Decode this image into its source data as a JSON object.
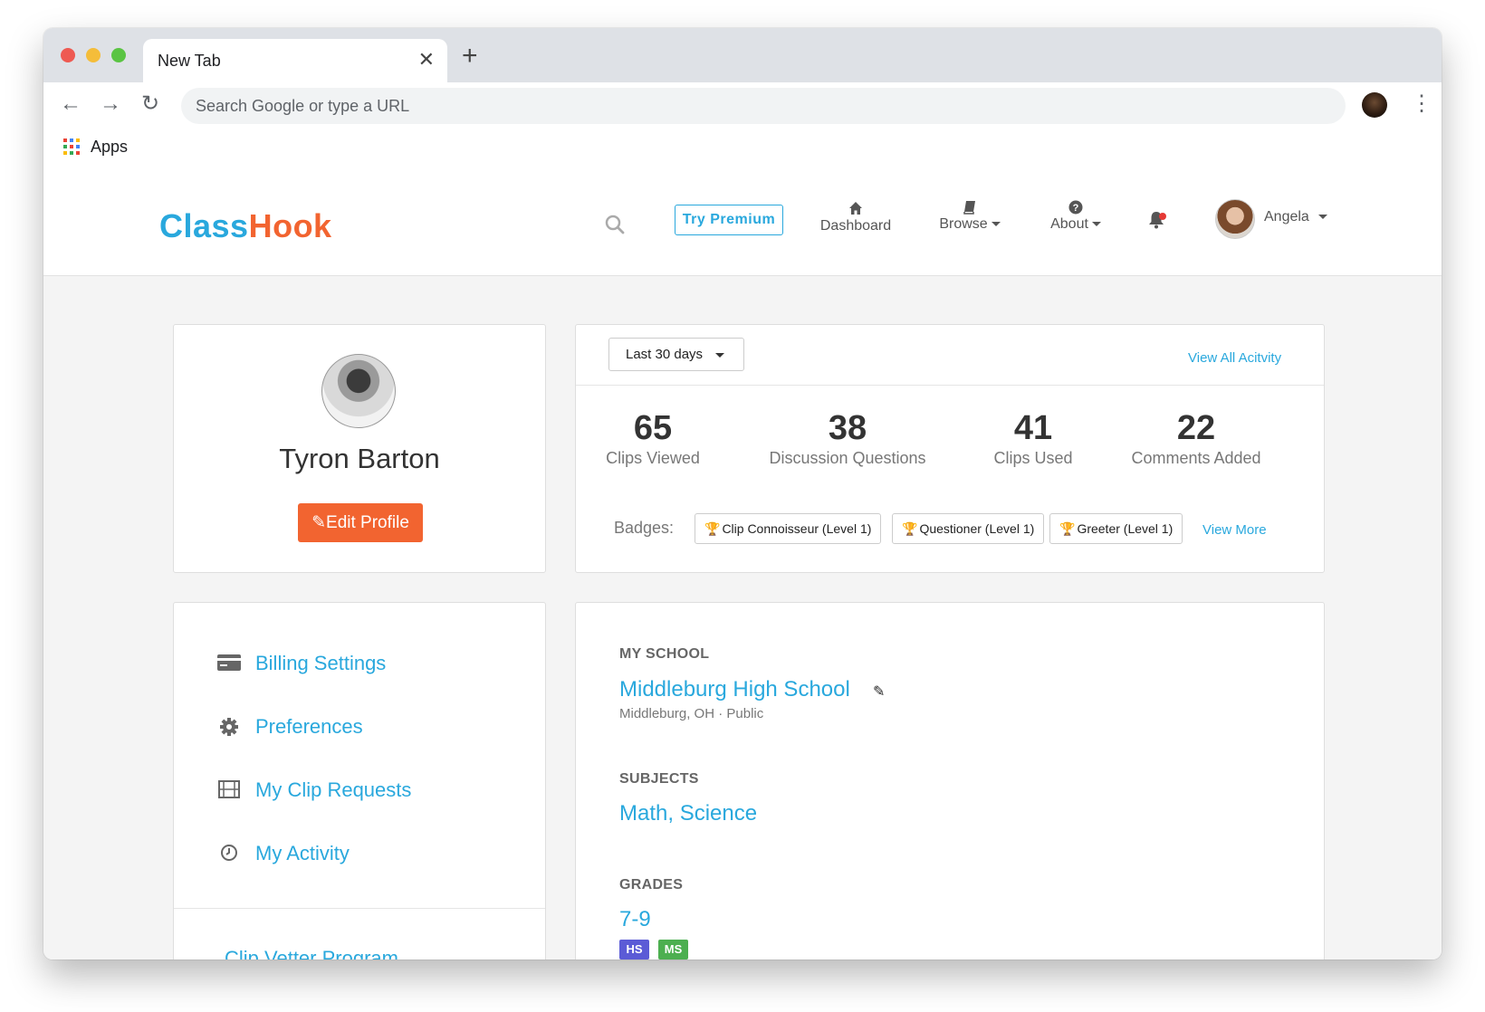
{
  "browser": {
    "tab_title": "New Tab",
    "tab_close": "✕",
    "new_tab": "+",
    "back": "←",
    "forward": "→",
    "reload": "↻",
    "omnibox_placeholder": "Search Google or type a URL",
    "menu": "⋮",
    "bookmarks": {
      "apps_label": "Apps"
    }
  },
  "site": {
    "logo_part1": "Class",
    "logo_part2": "Hook",
    "try_premium": "Try Premium",
    "nav": {
      "dashboard": {
        "label": "Dashboard",
        "icon": "home-icon"
      },
      "browse": {
        "label": "Browse",
        "icon": "book-icon"
      },
      "about": {
        "label": "About",
        "icon": "question-circle-icon"
      }
    },
    "user_name": "Angela"
  },
  "profile": {
    "name": "Tyron Barton",
    "edit_label": "Edit Profile"
  },
  "activity": {
    "range": "Last 30 days",
    "view_all": "View All Acitvity",
    "stats": [
      {
        "value": "65",
        "label": "Clips Viewed"
      },
      {
        "value": "38",
        "label": "Discussion Questions"
      },
      {
        "value": "41",
        "label": "Clips Used"
      },
      {
        "value": "22",
        "label": "Comments Added"
      }
    ],
    "badges_label": "Badges:",
    "badges": [
      "Clip Connoisseur (Level 1)",
      "Questioner (Level 1)",
      "Greeter (Level 1)"
    ],
    "view_more": "View More"
  },
  "menu": {
    "items": [
      {
        "label": "Billing Settings",
        "icon": "credit-card-icon"
      },
      {
        "label": "Preferences",
        "icon": "gear-icon"
      },
      {
        "label": "My Clip Requests",
        "icon": "film-icon"
      },
      {
        "label": "My Activity",
        "icon": "clock-icon"
      }
    ],
    "vetter": "Clip Vetter Program"
  },
  "school": {
    "my_school_label": "MY SCHOOL",
    "name": "Middleburg High School",
    "details": "Middleburg, OH · Public",
    "subjects_label": "SUBJECTS",
    "subjects": "Math, Science",
    "grades_label": "GRADES",
    "grades": "7-9",
    "grade_badges": [
      "HS",
      "MS"
    ]
  },
  "colors": {
    "brand_blue": "#29a8dd",
    "brand_orange": "#f26430",
    "hs_badge": "#5b5bd6",
    "ms_badge": "#4caf50"
  }
}
